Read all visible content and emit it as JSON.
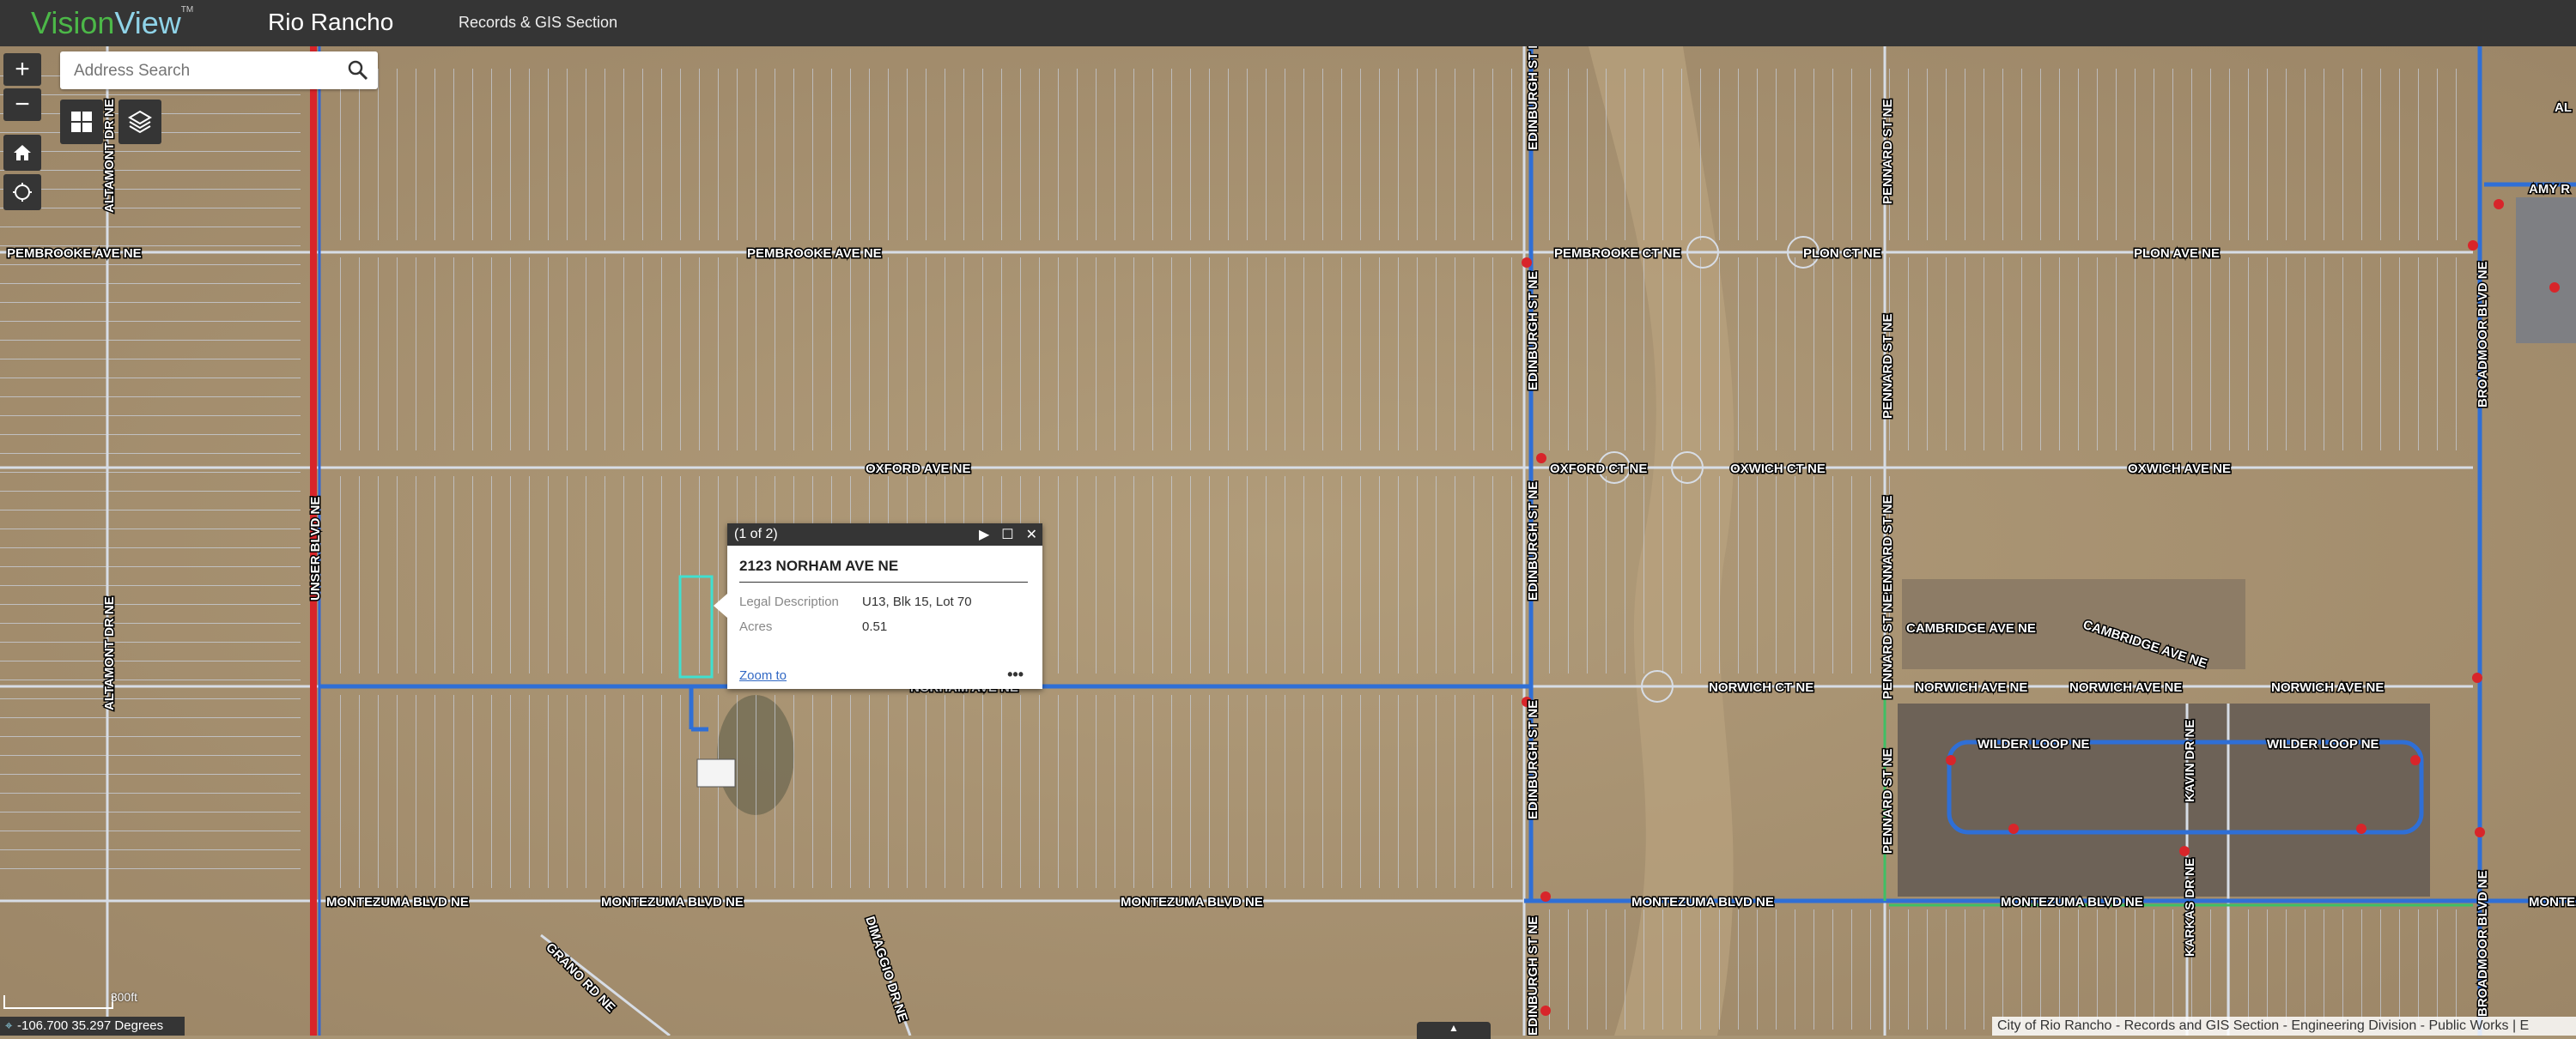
{
  "header": {
    "brand_part1": "Vision",
    "brand_part2": "View",
    "brand_tm": "TM",
    "city": "Rio Rancho",
    "section": "Records & GIS Section"
  },
  "search": {
    "placeholder": "Address Search"
  },
  "controls": {
    "zoom_in": "+",
    "zoom_out": "−"
  },
  "popup": {
    "count": "(1 of 2)",
    "title": "2123 NORHAM AVE NE",
    "fields": [
      {
        "label": "Legal Description",
        "value": "U13, Blk 15, Lot 70"
      },
      {
        "label": "Acres",
        "value": "0.51"
      }
    ],
    "zoom_to": "Zoom to",
    "more": "•••"
  },
  "status": {
    "coordinates": "-106.700 35.297 Degrees",
    "scale": "300ft",
    "attribution": "City of Rio Rancho - Records and GIS Section - Engineering Division - Public Works | E"
  },
  "map_labels": {
    "pembrooke_w": "PEMBROOKE AVE NE",
    "pembrooke_c": "PEMBROOKE AVE NE",
    "pembrooke_ct": "PEMBROOKE CT NE",
    "plon_ct": "PLON CT NE",
    "plon_ave": "PLON AVE NE",
    "oxford": "OXFORD AVE NE",
    "oxford_ct": "OXFORD CT NE",
    "oxwich_ct": "OXWICH CT NE",
    "oxwich_ave": "OXWICH AVE NE",
    "cambridge_1": "CAMBRIDGE AVE NE",
    "cambridge_2": "CAMBRIDGE AVE NE",
    "norwich_ct": "NORWICH CT NE",
    "norwich_1": "NORWICH AVE NE",
    "norwich_2": "NORWICH AVE NE",
    "norwich_3": "NORWICH AVE NE",
    "wilder_1": "WILDER LOOP NE",
    "wilder_2": "WILDER LOOP NE",
    "montezuma_1": "MONTEZUMA BLVD NE",
    "montezuma_2": "MONTEZUMA BLVD NE",
    "montezuma_3": "MONTEZUMA BLVD NE",
    "montezuma_4": "MONTEZUMA BLVD NE",
    "montezuma_5": "MONTEZUMA BLVD NE",
    "montezuma_6": "MONTEZ",
    "amy": "AMY R",
    "al": "AL",
    "unser": "UNSER BLVD NE",
    "altamont_top": "ALTAMONT DR NE",
    "altamont_mid": "ALTAMONT DR NE",
    "edinburgh_top": "EDINBURGH ST NE",
    "edinburgh_2": "EDINBURGH ST NE",
    "edinburgh_3": "EDINBURGH ST NE",
    "edinburgh_4": "EDINBURGH ST NE",
    "edinburgh_5": "EDINBURGH ST NE",
    "pennard_1": "PENNARD ST NE",
    "pennard_2": "PENNARD ST NE",
    "pennard_3": "PENNARD ST NE",
    "pennard_4": "PENNARD ST NE",
    "pennard_5": "PENNARD ST NE",
    "broadmoor_1": "BROADMOOR BLVD NE",
    "broadmoor_2": "BROADMOOR BLVD NE",
    "kavin": "KAVIN DR NE",
    "karkas": "KARKAS DR NE",
    "grand_rd": "GRANO RD NE",
    "dimaggio": "DIMAGGIO DR NE",
    "norham_partial": "NORHAM AVE NE"
  },
  "colors": {
    "header_bg": "#353535",
    "brand_green": "#4cb848",
    "water_line": "#2f6fd6",
    "arterial": "#d8252a",
    "parcel_line": "#c9d0dc",
    "selected_parcel": "#3fe0d0",
    "terrain": "#a89474"
  }
}
